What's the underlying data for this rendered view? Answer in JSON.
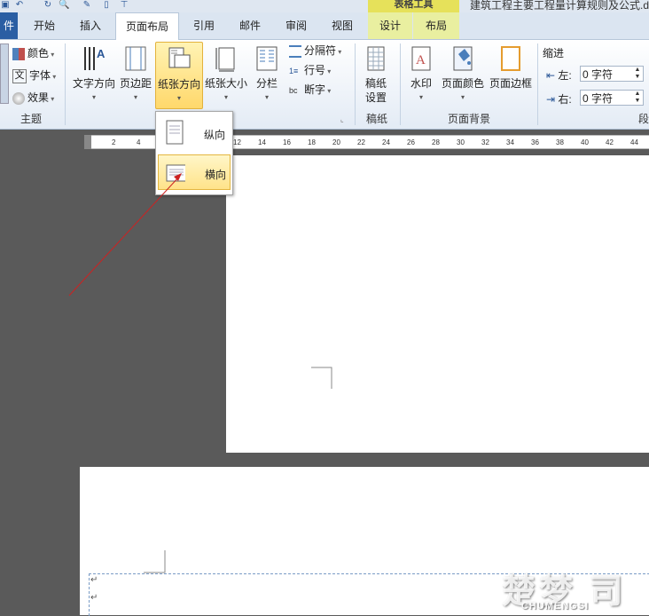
{
  "titlebar": {
    "context_header": "表格工具",
    "doc_title": "建筑工程主要工程量计算规则及公式.d"
  },
  "tabs": [
    {
      "label": "件"
    },
    {
      "label": "开始"
    },
    {
      "label": "插入"
    },
    {
      "label": "页面布局"
    },
    {
      "label": "引用"
    },
    {
      "label": "邮件"
    },
    {
      "label": "审阅"
    },
    {
      "label": "视图"
    },
    {
      "label": "设计"
    },
    {
      "label": "布局"
    }
  ],
  "ribbon": {
    "theme": {
      "colors": "颜色",
      "fonts": "字体",
      "effects": "效果",
      "group": "主题"
    },
    "page_setup": {
      "text_direction": "文字方向",
      "margins": "页边距",
      "orientation": "纸张方向",
      "size": "纸张大小",
      "columns": "分栏",
      "breaks": "分隔符",
      "line_numbers": "行号",
      "hyphenation": "断字"
    },
    "draft": {
      "settings": "稿纸\n设置",
      "settings_l1": "稿纸",
      "settings_l2": "设置",
      "group": "稿纸"
    },
    "page_background": {
      "watermark": "水印",
      "page_color": "页面颜色",
      "page_borders": "页面边框",
      "group": "页面背景"
    },
    "paragraph": {
      "indent_title": "缩进",
      "left_label": "左:",
      "left_value": "0 字符",
      "right_label": "右:",
      "right_value": "0 字符",
      "group_partial": "段"
    }
  },
  "orientation_menu": {
    "portrait": "纵向",
    "landscape": "横向"
  },
  "ruler": {
    "ticks": [
      "2",
      "4",
      "12",
      "14",
      "16",
      "18",
      "20",
      "22",
      "24",
      "26",
      "28",
      "30",
      "32",
      "34",
      "36",
      "38",
      "40",
      "42",
      "44"
    ]
  },
  "watermark_logo": {
    "big": "楚梦 司",
    "small": "CHUMENGSI"
  },
  "colors": {
    "file_tab": "#2a5ea3",
    "highlight": "#ffd86b",
    "arrow": "#cc2222"
  }
}
